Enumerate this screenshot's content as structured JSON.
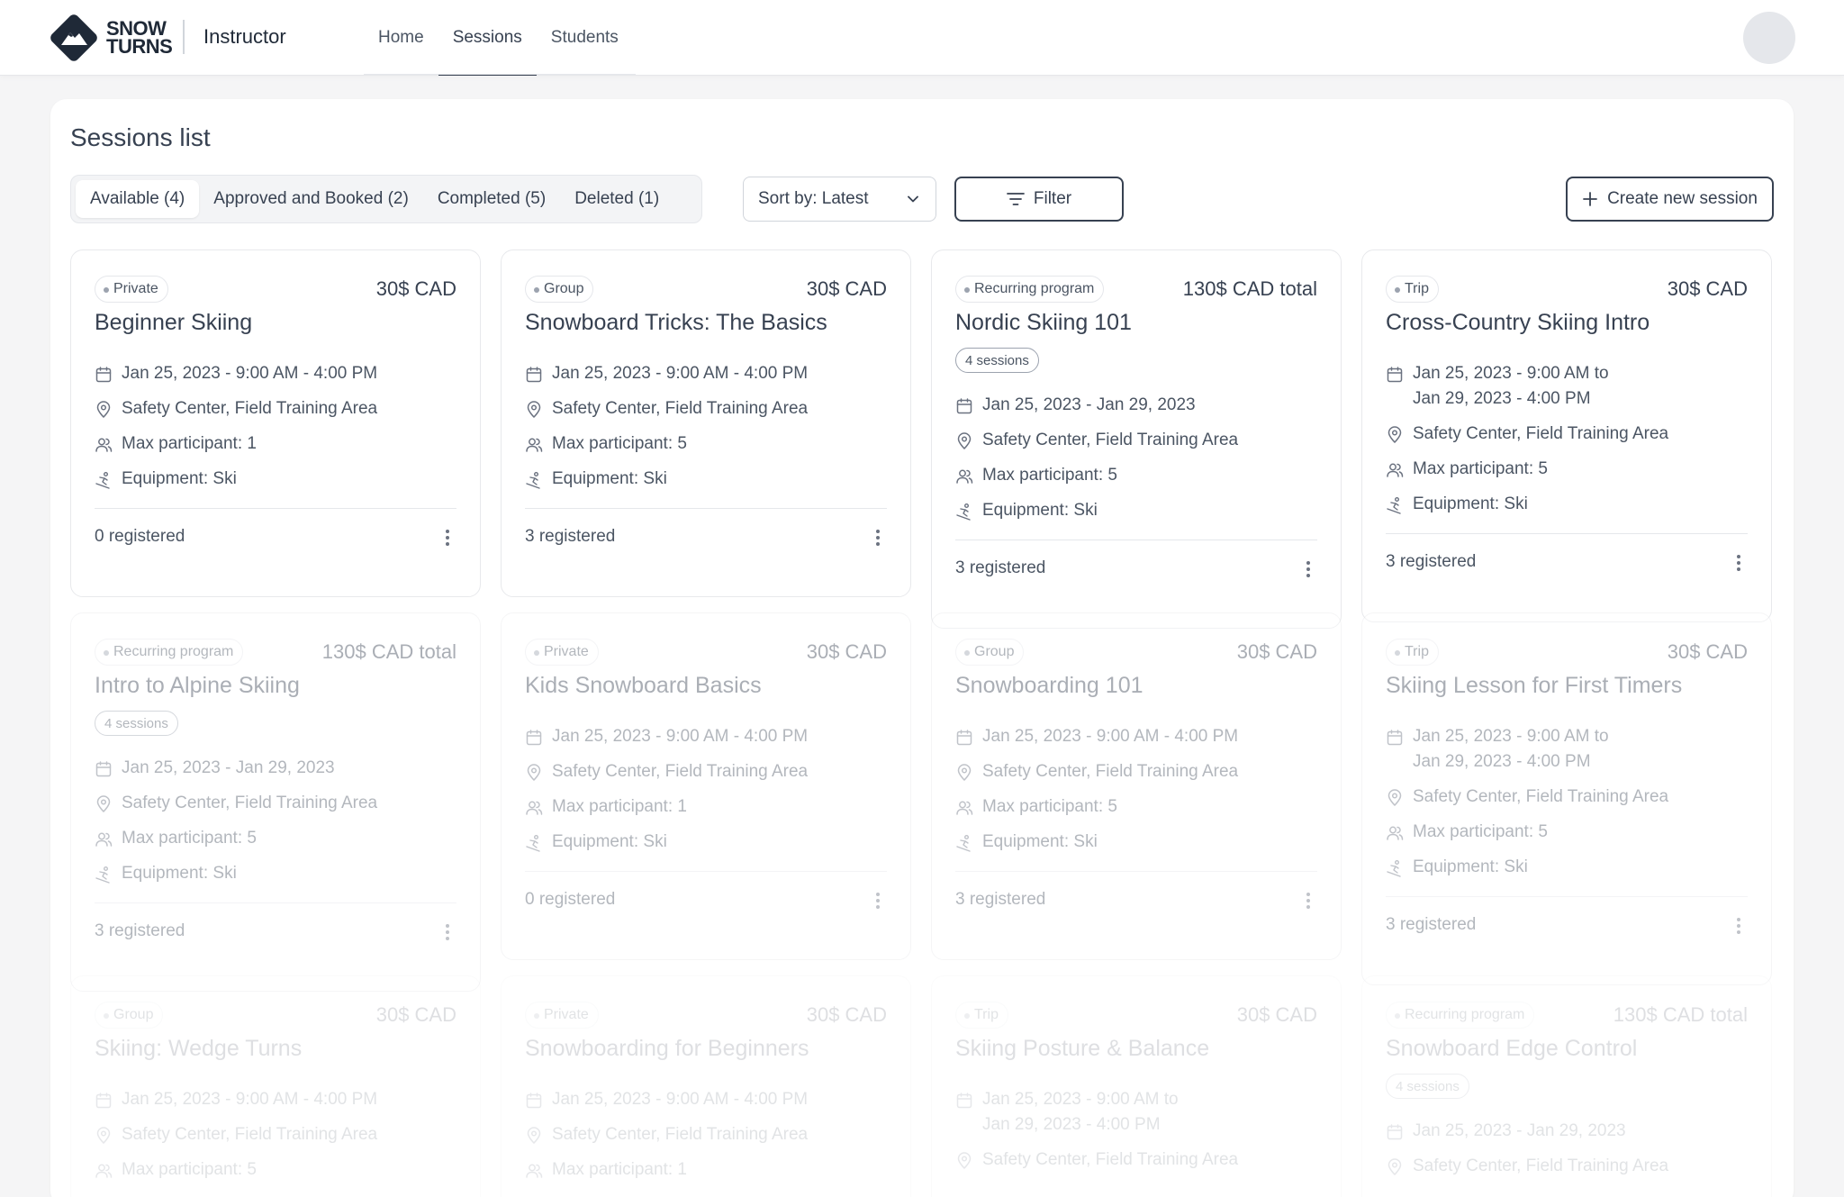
{
  "header": {
    "logo_line1": "SNOW",
    "logo_line2": "TURNS",
    "app_label": "Instructor",
    "nav": [
      {
        "label": "Home",
        "active": false
      },
      {
        "label": "Sessions",
        "active": true
      },
      {
        "label": "Students",
        "active": false
      }
    ]
  },
  "main": {
    "title": "Sessions list",
    "tabs": [
      {
        "label": "Available (4)",
        "active": true
      },
      {
        "label": "Approved and Booked (2)",
        "active": false
      },
      {
        "label": "Completed (5)",
        "active": false
      },
      {
        "label": "Deleted (1)",
        "active": false
      }
    ],
    "sort_label": "Sort by: Latest",
    "filter_label": "Filter",
    "create_label": "Create new session"
  },
  "cards": [
    {
      "type": "Private",
      "price": "30$ CAD",
      "title": "Beginner Skiing",
      "sessions": null,
      "date": [
        "Jan 25, 2023 - 9:00 AM - 4:00 PM"
      ],
      "location": "Safety Center, Field Training Area",
      "participants": "Max participant: 1",
      "equipment": "Equipment: Ski",
      "registered": "0 registered"
    },
    {
      "type": "Group",
      "price": "30$ CAD",
      "title": "Snowboard Tricks: The Basics",
      "sessions": null,
      "date": [
        "Jan 25, 2023 - 9:00 AM - 4:00 PM"
      ],
      "location": "Safety Center, Field Training Area",
      "participants": "Max participant: 5",
      "equipment": "Equipment: Ski",
      "registered": "3 registered"
    },
    {
      "type": "Recurring program",
      "price": "130$ CAD total",
      "title": "Nordic Skiing 101",
      "sessions": "4 sessions",
      "date": [
        "Jan 25, 2023 - Jan 29, 2023"
      ],
      "location": "Safety Center, Field Training Area",
      "participants": "Max participant: 5",
      "equipment": "Equipment: Ski",
      "registered": "3 registered"
    },
    {
      "type": "Trip",
      "price": "30$ CAD",
      "title": "Cross-Country Skiing Intro",
      "sessions": null,
      "date": [
        "Jan 25, 2023 - 9:00 AM to",
        "Jan 29, 2023 - 4:00 PM"
      ],
      "location": "Safety Center, Field Training Area",
      "participants": "Max participant: 5",
      "equipment": "Equipment: Ski",
      "registered": "3 registered"
    },
    {
      "type": "Recurring program",
      "price": "130$ CAD total",
      "title": "Intro to Alpine Skiing",
      "sessions": "4 sessions",
      "date": [
        "Jan 25, 2023 - Jan 29, 2023"
      ],
      "location": "Safety Center, Field Training Area",
      "participants": "Max participant: 5",
      "equipment": "Equipment: Ski",
      "registered": "3 registered"
    },
    {
      "type": "Private",
      "price": "30$ CAD",
      "title": "Kids Snowboard Basics",
      "sessions": null,
      "date": [
        "Jan 25, 2023 - 9:00 AM - 4:00 PM"
      ],
      "location": "Safety Center, Field Training Area",
      "participants": "Max participant: 1",
      "equipment": "Equipment: Ski",
      "registered": "0 registered"
    },
    {
      "type": "Group",
      "price": "30$ CAD",
      "title": "Snowboarding 101",
      "sessions": null,
      "date": [
        "Jan 25, 2023 - 9:00 AM - 4:00 PM"
      ],
      "location": "Safety Center, Field Training Area",
      "participants": "Max participant: 5",
      "equipment": "Equipment: Ski",
      "registered": "3 registered"
    },
    {
      "type": "Trip",
      "price": "30$ CAD",
      "title": "Skiing Lesson for First Timers",
      "sessions": null,
      "date": [
        "Jan 25, 2023 - 9:00 AM to",
        "Jan 29, 2023 - 4:00 PM"
      ],
      "location": "Safety Center, Field Training Area",
      "participants": "Max participant: 5",
      "equipment": "Equipment: Ski",
      "registered": "3 registered"
    },
    {
      "type": "Group",
      "price": "30$ CAD",
      "title": "Skiing: Wedge Turns",
      "sessions": null,
      "date": [
        "Jan 25, 2023 - 9:00 AM - 4:00 PM"
      ],
      "location": "Safety Center, Field Training Area",
      "participants": "Max participant: 5",
      "equipment": null,
      "registered": null
    },
    {
      "type": "Private",
      "price": "30$ CAD",
      "title": "Snowboarding for Beginners",
      "sessions": null,
      "date": [
        "Jan 25, 2023 - 9:00 AM - 4:00 PM"
      ],
      "location": "Safety Center, Field Training Area",
      "participants": "Max participant: 1",
      "equipment": null,
      "registered": null
    },
    {
      "type": "Trip",
      "price": "30$ CAD",
      "title": "Skiing Posture & Balance",
      "sessions": null,
      "date": [
        "Jan 25, 2023 - 9:00 AM to",
        "Jan 29, 2023 - 4:00 PM"
      ],
      "location": "Safety Center, Field Training Area",
      "participants": null,
      "equipment": null,
      "registered": null
    },
    {
      "type": "Recurring program",
      "price": "130$ CAD total",
      "title": "Snowboard Edge Control",
      "sessions": "4 sessions",
      "date": [
        "Jan 25, 2023 - Jan 29, 2023"
      ],
      "location": "Safety Center, Field Training Area",
      "participants": null,
      "equipment": null,
      "registered": null
    }
  ],
  "icons": {
    "calendar": "calendar-icon",
    "location": "location-pin-icon",
    "participants": "users-icon",
    "equipment": "ski-icon",
    "more": "more-vertical-icon"
  },
  "colors": {
    "accent": "#374151",
    "muted": "#4b5563",
    "border": "#e5e7eb"
  }
}
